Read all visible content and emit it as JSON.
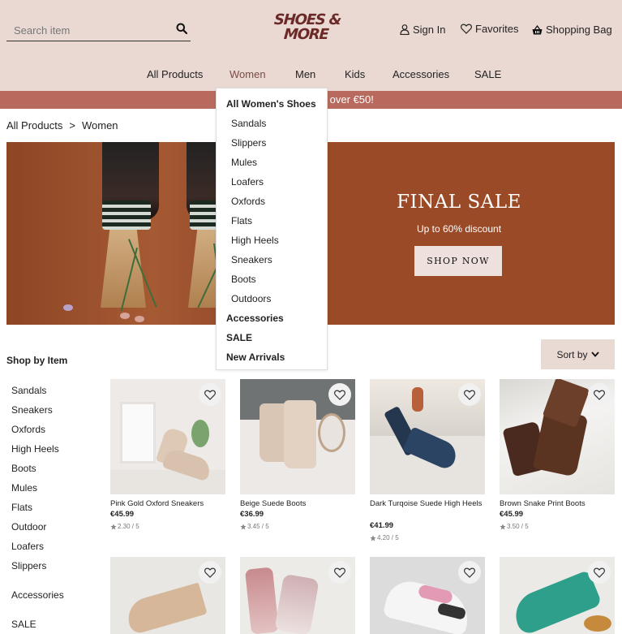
{
  "header": {
    "search_placeholder": "Search item",
    "logo": [
      "SHOES &",
      "MORE"
    ],
    "sign_in": "Sign In",
    "favorites": "Favorites",
    "shopping_bag": "Shopping Bag"
  },
  "nav": {
    "items": [
      "All Products",
      "Women",
      "Men",
      "Kids",
      "Accessories",
      "SALE"
    ],
    "active": "Women"
  },
  "promo": {
    "text": "ers over €50!"
  },
  "breadcrumb": {
    "items": [
      "All Products",
      "Women"
    ],
    "separator": ">"
  },
  "hero": {
    "title": "FINAL SALE",
    "subtitle": "Up to 60% discount",
    "button": "SHOP NOW"
  },
  "dropdown": {
    "header": "All Women's Shoes",
    "items": [
      "Sandals",
      "Slippers",
      "Mules",
      "Loafers",
      "Oxfords",
      "Flats",
      "High Heels",
      "Sneakers",
      "Boots",
      "Outdoors"
    ],
    "extra": [
      "Accessories",
      "SALE",
      "New Arrivals"
    ]
  },
  "sidebar": {
    "title": "Shop by Item",
    "items": [
      "Sandals",
      "Sneakers",
      "Oxfords",
      "High Heels",
      "Boots",
      "Mules",
      "Flats",
      "Outdoor",
      "Loafers",
      "Slippers"
    ],
    "extra": [
      "Accessories",
      "SALE"
    ]
  },
  "sort": {
    "label": "Sort by"
  },
  "products": [
    {
      "name": "Pink Gold Oxford Sneakers",
      "price": "€45.99",
      "rating": "2.30 / 5"
    },
    {
      "name": "Beige Suede Boots",
      "price": "€36.99",
      "rating": "3.45 / 5"
    },
    {
      "name": "Dark Turqoise Suede High Heels",
      "price": "€41.99",
      "rating": "4.20 / 5"
    },
    {
      "name": "Brown Snake Print Boots",
      "price": "€45.99",
      "rating": "3.50 / 5"
    }
  ],
  "colors": {
    "header_bg": "#ead9d2",
    "promo_bg": "#b86a5e",
    "hero_bg": "#9a4a26",
    "logo": "#6b2a28",
    "active_nav": "#7b4b46"
  }
}
